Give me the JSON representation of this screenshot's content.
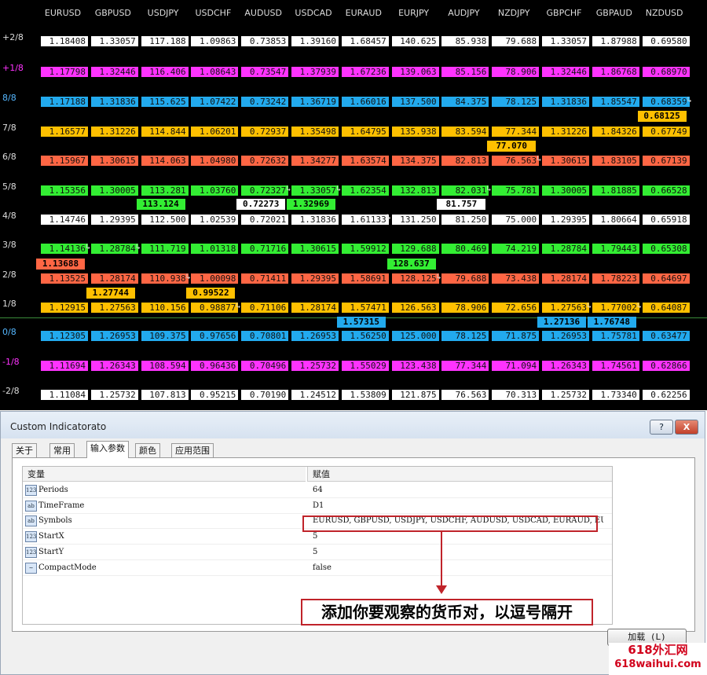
{
  "colors": {
    "p2": "#ffffff",
    "p1": "#ff33ff",
    "l8": "#22aaee",
    "l7": "#ffc000",
    "l6": "#ff6644",
    "l5": "#33ee33",
    "l4": "#ffffff",
    "l3": "#33ee33",
    "l2": "#ff6644",
    "l1": "#ffc000",
    "l0": "#22aaee",
    "m1": "#ff33ff",
    "m2": "#ffffff",
    "green_line": "#3a8a3a",
    "callout_red": "#c0232a"
  },
  "chart": {
    "pairs": [
      "EURUSD",
      "GBPUSD",
      "USDJPY",
      "USDCHF",
      "AUDUSD",
      "USDCAD",
      "EURAUD",
      "EURJPY",
      "AUDJPY",
      "NZDJPY",
      "GBPCHF",
      "GBPAUD",
      "NZDUSD"
    ],
    "levels": [
      {
        "label": "+2/8",
        "color": "p2",
        "values": [
          "1.18408",
          "1.33057",
          "117.188",
          "1.09863",
          "0.73853",
          "1.39160",
          "1.68457",
          "140.625",
          "85.938",
          "79.688",
          "1.33057",
          "1.87988",
          "0.69580"
        ]
      },
      {
        "label": "+1/8",
        "color": "p1",
        "values": [
          "1.17798",
          "1.32446",
          "116.406",
          "1.08643",
          "0.73547",
          "1.37939",
          "1.67236",
          "139.063",
          "85.156",
          "78.906",
          "1.32446",
          "1.86768",
          "0.68970"
        ]
      },
      {
        "label": "8/8",
        "color": "l8",
        "values": [
          "1.17188",
          "1.31836",
          "115.625",
          "1.07422",
          "0.73242",
          "1.36719",
          "1.66016",
          "137.500",
          "84.375",
          "78.125",
          "1.31836",
          "1.85547",
          "0.68359"
        ]
      },
      {
        "label": "7/8",
        "color": "l7",
        "values": [
          "1.16577",
          "1.31226",
          "114.844",
          "1.06201",
          "0.72937",
          "1.35498",
          "1.64795",
          "135.938",
          "83.594",
          "77.344",
          "1.31226",
          "1.84326",
          "0.67749"
        ]
      },
      {
        "label": "6/8",
        "color": "l6",
        "values": [
          "1.15967",
          "1.30615",
          "114.063",
          "1.04980",
          "0.72632",
          "1.34277",
          "1.63574",
          "134.375",
          "82.813",
          "76.563",
          "1.30615",
          "1.83105",
          "0.67139"
        ]
      },
      {
        "label": "5/8",
        "color": "l5",
        "values": [
          "1.15356",
          "1.30005",
          "113.281",
          "1.03760",
          "0.72327",
          "1.33057",
          "1.62354",
          "132.813",
          "82.031",
          "75.781",
          "1.30005",
          "1.81885",
          "0.66528"
        ]
      },
      {
        "label": "4/8",
        "color": "l4",
        "values": [
          "1.14746",
          "1.29395",
          "112.500",
          "1.02539",
          "0.72021",
          "1.31836",
          "1.61133",
          "131.250",
          "81.250",
          "75.000",
          "1.29395",
          "1.80664",
          "0.65918"
        ]
      },
      {
        "label": "3/8",
        "color": "l3",
        "values": [
          "1.14136",
          "1.28784",
          "111.719",
          "1.01318",
          "0.71716",
          "1.30615",
          "1.59912",
          "129.688",
          "80.469",
          "74.219",
          "1.28784",
          "1.79443",
          "0.65308"
        ]
      },
      {
        "label": "2/8",
        "color": "l2",
        "values": [
          "1.13525",
          "1.28174",
          "110.938",
          "1.00098",
          "0.71411",
          "1.29395",
          "1.58691",
          "128.125",
          "79.688",
          "73.438",
          "1.28174",
          "1.78223",
          "0.64697"
        ]
      },
      {
        "label": "1/8",
        "color": "l1",
        "values": [
          "1.12915",
          "1.27563",
          "110.156",
          "0.98877",
          "0.71106",
          "1.28174",
          "1.57471",
          "126.563",
          "78.906",
          "72.656",
          "1.27563",
          "1.77002",
          "0.64087"
        ]
      },
      {
        "label": "0/8",
        "color": "l0",
        "values": [
          "1.12305",
          "1.26953",
          "109.375",
          "0.97656",
          "0.70801",
          "1.26953",
          "1.56250",
          "125.000",
          "78.125",
          "71.875",
          "1.26953",
          "1.75781",
          "0.63477"
        ]
      },
      {
        "label": "-1/8",
        "color": "m1",
        "values": [
          "1.11694",
          "1.26343",
          "108.594",
          "0.96436",
          "0.70496",
          "1.25732",
          "1.55029",
          "123.438",
          "77.344",
          "71.094",
          "1.26343",
          "1.74561",
          "0.62866"
        ]
      },
      {
        "label": "-2/8",
        "color": "m2",
        "values": [
          "1.11084",
          "1.25732",
          "107.813",
          "0.95215",
          "0.70190",
          "1.24512",
          "1.53809",
          "121.875",
          "76.563",
          "70.313",
          "1.25732",
          "1.73340",
          "0.62256"
        ]
      }
    ],
    "current": [
      {
        "pair": "EURUSD",
        "value": "1.13688",
        "color": "l2"
      },
      {
        "pair": "GBPUSD",
        "value": "1.27744",
        "color": "l1"
      },
      {
        "pair": "USDJPY",
        "value": "113.124",
        "color": "l5"
      },
      {
        "pair": "USDCHF",
        "value": "0.99522",
        "color": "l1"
      },
      {
        "pair": "AUDUSD",
        "value": "0.72273",
        "color": "l4"
      },
      {
        "pair": "USDCAD",
        "value": "1.32969",
        "color": "l5"
      },
      {
        "pair": "EURAUD",
        "value": "1.57315",
        "color": "l0"
      },
      {
        "pair": "EURJPY",
        "value": "128.637",
        "color": "l3"
      },
      {
        "pair": "AUDJPY",
        "value": "81.757",
        "color": "l4"
      },
      {
        "pair": "NZDJPY",
        "value": "77.070",
        "color": "l7"
      },
      {
        "pair": "GBPCHF",
        "value": "1.27136",
        "color": "l0"
      },
      {
        "pair": "GBPAUD",
        "value": "1.76748",
        "color": "l0"
      },
      {
        "pair": "NZDUSD",
        "value": "0.68125",
        "color": "l7"
      }
    ]
  },
  "dialog": {
    "title": "Custom Indicatorato",
    "help_label": "?",
    "close_label": "X",
    "tabs": [
      "关于",
      "常用",
      "输入参数",
      "颜色",
      "应用范围"
    ],
    "active_tab": 2,
    "columns": {
      "variable": "变量",
      "value": "赋值"
    },
    "params": [
      {
        "icon": "123",
        "name": "Periods",
        "value": "64"
      },
      {
        "icon": "ab",
        "name": "TimeFrame",
        "value": "D1"
      },
      {
        "icon": "ab",
        "name": "Symbols",
        "value": "EURUSD, GBPUSD, USDJPY, USDCHF, AUDUSD, USDCAD, EURAUD, EURJPY, AU..."
      },
      {
        "icon": "123",
        "name": "StartX",
        "value": "5"
      },
      {
        "icon": "123",
        "name": "StartY",
        "value": "5"
      },
      {
        "icon": "~",
        "name": "CompactMode",
        "value": "false"
      }
    ],
    "callout": "添加你要观察的货币对，以逗号隔开",
    "load_button": "加载 (L)",
    "watermark_line1": "618外汇网",
    "watermark_line2": "618waihui.com"
  }
}
